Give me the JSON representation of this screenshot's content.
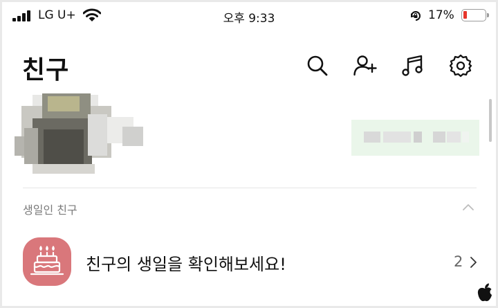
{
  "status_bar": {
    "carrier": "LG U+",
    "time": "오후 9:33",
    "battery_percent": "17%",
    "battery_level": 0.17,
    "signal_bars": 4
  },
  "header": {
    "title": "친구",
    "icons": [
      "search-icon",
      "add-friend-icon",
      "music-icon",
      "settings-icon"
    ]
  },
  "my_profile": {
    "avatar": "blurred-profile-photo",
    "status_message": "blurred"
  },
  "birthday_section": {
    "label": "생일인 친구",
    "item": {
      "text": "친구의 생일을 확인해보세요!",
      "count": "2",
      "icon": "birthday-cake-icon",
      "icon_color": "#d9777b"
    }
  }
}
